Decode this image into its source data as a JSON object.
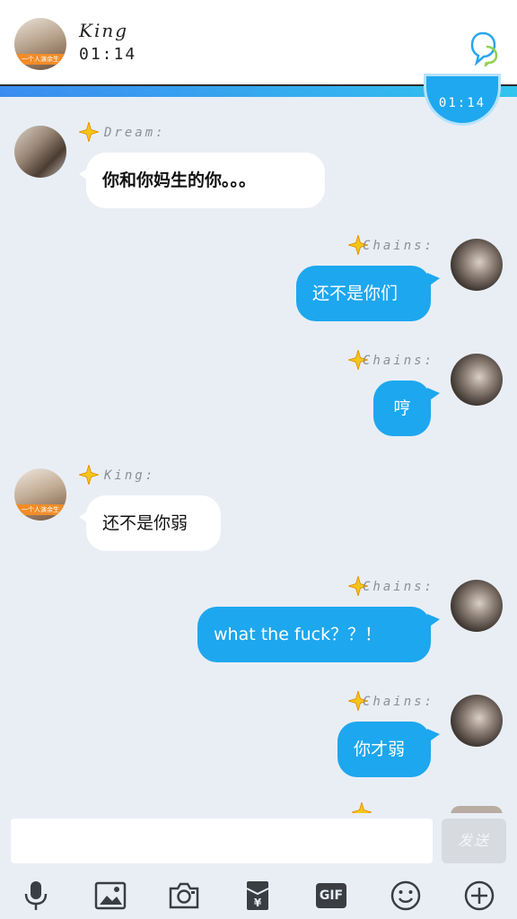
{
  "header": {
    "name": "King",
    "time": "01:14",
    "avatar_caption": "一个人演余生"
  },
  "time_bubble": "01:14",
  "messages": [
    {
      "sender": "Dream:",
      "text": "你和你妈生的你。。。",
      "side": "left"
    },
    {
      "sender": "Chains:",
      "text": "还不是你们",
      "side": "right"
    },
    {
      "sender": "Chains:",
      "text": "哼",
      "side": "right"
    },
    {
      "sender": "King:",
      "text": "还不是你弱",
      "side": "left",
      "avatar_caption": "一个人演余生"
    },
    {
      "sender": "Chains:",
      "text": "what the fuck？？！",
      "side": "right"
    },
    {
      "sender": "Chains:",
      "text": "你才弱",
      "side": "right"
    }
  ],
  "input": {
    "placeholder": "",
    "send_label": "发送"
  },
  "toolbar": {
    "gif_label": "GIF",
    "icons": [
      "microphone-icon",
      "image-icon",
      "camera-icon",
      "red-packet-icon",
      "gif-icon",
      "emoji-icon",
      "plus-icon"
    ]
  },
  "colors": {
    "accent": "#1da7ee",
    "star": "#f5c518",
    "background": "#e9eef5"
  }
}
